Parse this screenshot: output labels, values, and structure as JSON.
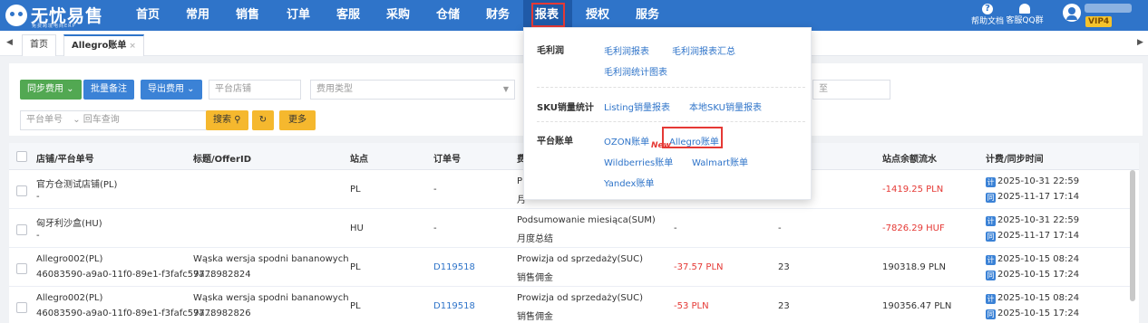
{
  "app": {
    "logo_text": "无忧易售",
    "logo_sub": "免费跨境电商ERP"
  },
  "nav": [
    {
      "label": "首页"
    },
    {
      "label": "常用"
    },
    {
      "label": "销售"
    },
    {
      "label": "订单"
    },
    {
      "label": "客服"
    },
    {
      "label": "采购"
    },
    {
      "label": "仓储"
    },
    {
      "label": "财务"
    },
    {
      "label": "报表"
    },
    {
      "label": "授权"
    },
    {
      "label": "服务"
    }
  ],
  "top_right": {
    "help_label": "帮助文档",
    "qq_label": "客服QQ群",
    "help_glyph": "?",
    "vip": "VIP4"
  },
  "tabs": [
    {
      "label": "首页"
    },
    {
      "label": "Allegro账单",
      "close": "×"
    }
  ],
  "tab_arrows": {
    "left": "◀",
    "right": "▶"
  },
  "filters": {
    "sync_fee": "同步费用 ⌄",
    "batch_note": "批量备注",
    "export_fee": "导出费用 ⌄",
    "platform_store_placeholder": "平台店铺",
    "fee_type_placeholder": "费用类型",
    "date_to": "至",
    "order_no_type": "平台单号",
    "search_placeholder": "回车查询",
    "search_btn": "搜索",
    "refresh_glyph": "↻",
    "more_btn": "更多"
  },
  "table": {
    "headers": [
      "店铺/平台单号",
      "标题/OfferID",
      "站点",
      "订单号",
      "费",
      "站点余额流水",
      "计费/同步时间"
    ],
    "tag_calc": "计",
    "tag_sync": "同",
    "rows": [
      {
        "store": "官方仓测试店铺(PL)",
        "order_ref": "-",
        "title": "",
        "offer_id": "",
        "site": "PL",
        "order_no": "-",
        "fee_type": "P",
        "fee_type_cn": "月",
        "amount": "",
        "qty": "",
        "balance": "-1419.25 PLN",
        "calc_time": "2025-10-31 22:59",
        "sync_time": "2025-11-17 17:14"
      },
      {
        "store": "匈牙利沙盒(HU)",
        "order_ref": "-",
        "title": "",
        "offer_id": "",
        "site": "HU",
        "order_no": "-",
        "fee_type": "Podsumowanie miesiąca(SUM)",
        "fee_type_cn": "月度总结",
        "amount": "-",
        "qty": "-",
        "balance": "-7826.29 HUF",
        "calc_time": "2025-10-31 22:59",
        "sync_time": "2025-11-17 17:14"
      },
      {
        "store": "Allegro002(PL)",
        "order_ref": "46083590-a9a0-11f0-89e1-f3fafc59a…",
        "title": "Wąska wersja spodni bananowych",
        "offer_id": "7778982824",
        "site": "PL",
        "order_no": "D119518",
        "fee_type": "Prowizja od sprzedaży(SUC)",
        "fee_type_cn": "销售佣金",
        "amount": "-37.57 PLN",
        "qty": "23",
        "balance": "190318.9 PLN",
        "calc_time": "2025-10-15 08:24",
        "sync_time": "2025-10-15 17:24"
      },
      {
        "store": "Allegro002(PL)",
        "order_ref": "46083590-a9a0-11f0-89e1-f3fafc59a…",
        "title": "Wąska wersja spodni bananowych",
        "offer_id": "7778982826",
        "site": "PL",
        "order_no": "D119518",
        "fee_type": "Prowizja od sprzedaży(SUC)",
        "fee_type_cn": "销售佣金",
        "amount": "-53 PLN",
        "qty": "23",
        "balance": "190356.47 PLN",
        "calc_time": "2025-10-15 08:24",
        "sync_time": "2025-10-15 17:24"
      }
    ]
  },
  "report_menu": {
    "groups": [
      {
        "label": "毛利润",
        "links": [
          "毛利润报表",
          "毛利润报表汇总",
          "毛利润统计图表"
        ]
      },
      {
        "label": "SKU销量统计",
        "links": [
          "Listing销量报表",
          "本地SKU销量报表"
        ]
      },
      {
        "label": "平台账单",
        "links": [
          "OZON账单",
          "Allegro账单",
          "Wildberries账单",
          "Walmart账单",
          "Yandex账单"
        ]
      }
    ],
    "new_badge": "New"
  },
  "colors": {
    "brand": "#2f74c9",
    "highlight": "#e53935",
    "green": "#52a852"
  }
}
